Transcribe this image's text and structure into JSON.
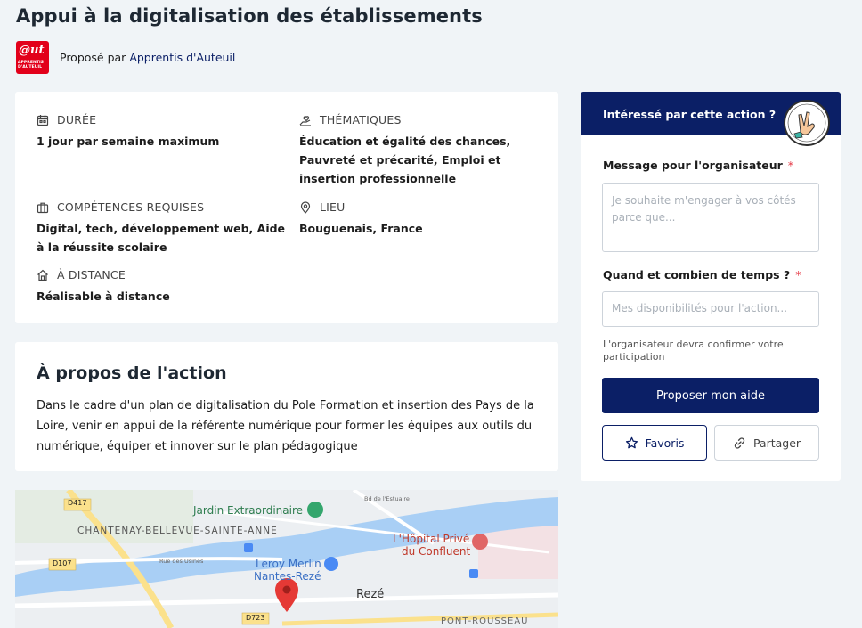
{
  "page": {
    "title": "Appui à la digitalisation des établissements"
  },
  "organizer": {
    "logo_text_top": "@ut",
    "logo_text_bottom": "APPRENTIS D'AUTEUIL",
    "prefix": "Proposé par",
    "name": "Apprentis d'Auteuil"
  },
  "info": {
    "duration_label": "DURÉE",
    "duration_value": "1 jour par semaine maximum",
    "themes_label": "THÉMATIQUES",
    "themes_value": "Éducation et égalité des chances, Pauvreté et précarité, Emploi et insertion professionnelle",
    "skills_label": "COMPÉTENCES REQUISES",
    "skills_value": "Digital, tech, développement web, Aide à la réussite scolaire",
    "location_label": "LIEU",
    "location_value": "Bouguenais, France",
    "remote_label": "À DISTANCE",
    "remote_value": "Réalisable à distance"
  },
  "about": {
    "title": "À propos de l'action",
    "text": "Dans le cadre d'un plan de digitalisation du Pole Formation et insertion des Pays de la Loire, venir en appui de la référente numérique pour former les équipes aux outils du numérique, équiper et innover sur le plan pédagogique"
  },
  "map": {
    "road_d417": "D417",
    "road_d107": "D107",
    "road_d723": "D723",
    "place_jardin": "Jardin Extraordinaire",
    "place_chantenay": "CHANTENAY-BELLEVUE-SAINTE-ANNE",
    "street_estuaire": "Bd de l'Estuaire",
    "street_usines": "Rue des Usines",
    "place_hopital_1": "L'Hôpital Privé",
    "place_hopital_2": "du Confluent",
    "place_leroy_1": "Leroy Merlin",
    "place_leroy_2": "Nantes-Rezé",
    "place_reze": "Rezé",
    "place_pont": "PONT-ROUSSEAU",
    "colors": {
      "water": "#a9cff5",
      "road_major": "#fbe18c",
      "pin": "#e53935"
    }
  },
  "sidebar": {
    "header": "Intéressé par cette action ?",
    "message_label": "Message pour l'organisateur",
    "required_mark": "*",
    "message_placeholder": "Je souhaite m'engager à vos côtés parce que...",
    "availability_label": "Quand et combien de temps ?",
    "availability_placeholder": "Mes disponibilités pour l'action...",
    "hint": "L'organisateur devra confirmer votre participation",
    "submit_label": "Proposer mon aide",
    "favorite_label": "Favoris",
    "share_label": "Partager"
  },
  "colors": {
    "primary": "#0b1f66",
    "required": "#e53946",
    "brand_red": "#e2001a"
  }
}
